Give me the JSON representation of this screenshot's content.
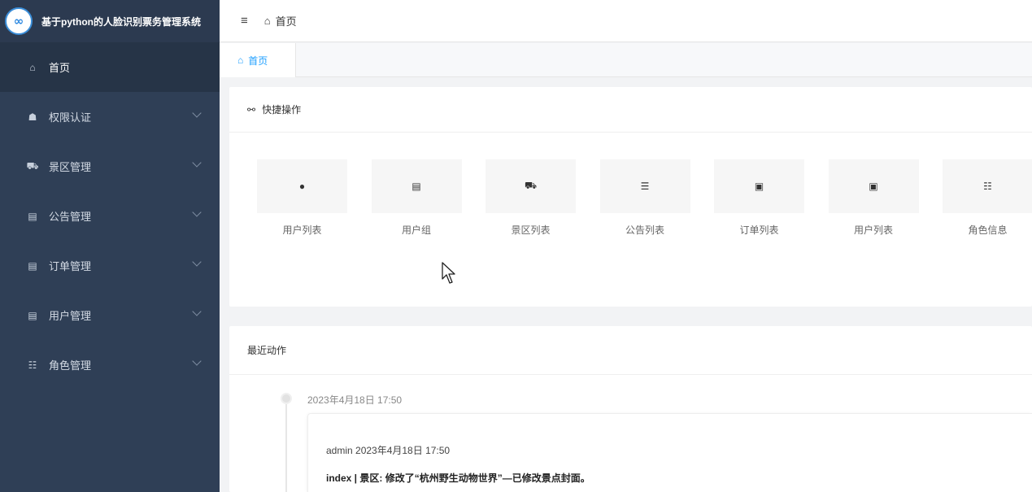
{
  "app": {
    "logo_glyph": "∞",
    "title": "基于python的人脸识别票务管理系统"
  },
  "sidebar": {
    "items": [
      {
        "label": "首页",
        "icon": "home-icon",
        "glyph": "⌂",
        "active": true,
        "has_arrow": false
      },
      {
        "label": "权限认证",
        "icon": "user-key-icon",
        "glyph": "☗",
        "active": false,
        "has_arrow": true
      },
      {
        "label": "景区管理",
        "icon": "car-icon",
        "glyph": "⛟",
        "active": false,
        "has_arrow": true
      },
      {
        "label": "公告管理",
        "icon": "list-icon",
        "glyph": "▤",
        "active": false,
        "has_arrow": true
      },
      {
        "label": "订单管理",
        "icon": "list-icon",
        "glyph": "▤",
        "active": false,
        "has_arrow": true
      },
      {
        "label": "用户管理",
        "icon": "list-icon",
        "glyph": "▤",
        "active": false,
        "has_arrow": true
      },
      {
        "label": "角色管理",
        "icon": "users-icon",
        "glyph": "☷",
        "active": false,
        "has_arrow": true
      }
    ]
  },
  "header": {
    "menu_glyph": "≡",
    "crumb_glyph": "⌂",
    "breadcrumb": "首页"
  },
  "tabs": {
    "glyph": "⌂",
    "items": [
      {
        "label": "首页"
      }
    ]
  },
  "quick_actions": {
    "title": "快捷操作",
    "title_glyph": "⚯",
    "items": [
      {
        "label": "用户列表",
        "icon": "user-icon",
        "glyph": "●"
      },
      {
        "label": "用户组",
        "icon": "list-icon",
        "glyph": "▤"
      },
      {
        "label": "景区列表",
        "icon": "car-icon",
        "glyph": "⛟"
      },
      {
        "label": "公告列表",
        "icon": "list-ul-icon",
        "glyph": "☰"
      },
      {
        "label": "订单列表",
        "icon": "image-icon",
        "glyph": "▣"
      },
      {
        "label": "用户列表",
        "icon": "image-icon",
        "glyph": "▣"
      },
      {
        "label": "角色信息",
        "icon": "users-icon",
        "glyph": "☷"
      }
    ]
  },
  "recent": {
    "title": "最近动作",
    "entries": [
      {
        "time": "2023年4月18日 17:50",
        "meta": "admin 2023年4月18日 17:50",
        "message": "index | 景区: 修改了“杭州野生动物世界”—已修改景点封面。"
      }
    ]
  }
}
